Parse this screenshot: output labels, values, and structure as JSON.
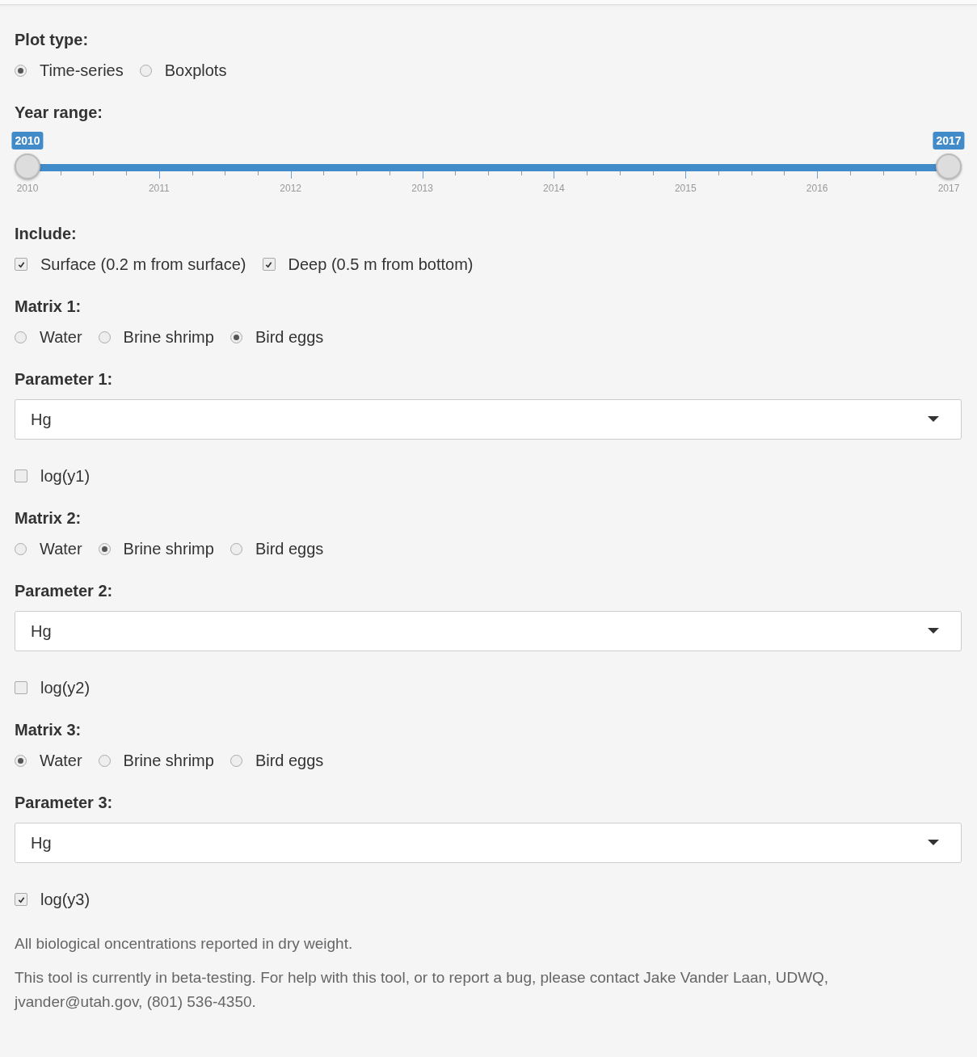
{
  "sections": [
    {
      "kind": "radio",
      "label": "Plot type:",
      "options": [
        {
          "label": "Time-series",
          "selected": true
        },
        {
          "label": "Boxplots",
          "selected": false
        }
      ]
    },
    {
      "kind": "slider",
      "label": "Year range:",
      "from": {
        "value": "2010",
        "level": 0
      },
      "to": {
        "value": "2017",
        "level": 1
      },
      "ticks": [
        "2010",
        "2011",
        "2012",
        "2013",
        "2014",
        "2015",
        "2016",
        "2017"
      ]
    },
    {
      "kind": "checks",
      "label": "Include:",
      "options": [
        {
          "label": "Surface (0.2 m from surface)",
          "checked": true
        },
        {
          "label": "Deep (0.5 m from bottom)",
          "checked": true
        }
      ]
    },
    {
      "kind": "radio",
      "label": "Matrix 1:",
      "options": [
        {
          "label": "Water",
          "selected": false
        },
        {
          "label": "Brine shrimp",
          "selected": false
        },
        {
          "label": "Bird eggs",
          "selected": true
        }
      ]
    },
    {
      "kind": "select",
      "label": "Parameter 1:",
      "value": "Hg"
    },
    {
      "kind": "checks",
      "options": [
        {
          "label": "log(y1)",
          "checked": false
        }
      ]
    },
    {
      "kind": "radio",
      "label": "Matrix 2:",
      "options": [
        {
          "label": "Water",
          "selected": false
        },
        {
          "label": "Brine shrimp",
          "selected": true
        },
        {
          "label": "Bird eggs",
          "selected": false
        }
      ]
    },
    {
      "kind": "select",
      "label": "Parameter 2:",
      "value": "Hg"
    },
    {
      "kind": "checks",
      "options": [
        {
          "label": "log(y2)",
          "checked": false
        }
      ]
    },
    {
      "kind": "radio",
      "label": "Matrix 3:",
      "options": [
        {
          "label": "Water",
          "selected": true
        },
        {
          "label": "Brine shrimp",
          "selected": false
        },
        {
          "label": "Bird eggs",
          "selected": false
        }
      ]
    },
    {
      "kind": "select",
      "label": "Parameter 3:",
      "value": "Hg"
    },
    {
      "kind": "checks",
      "options": [
        {
          "label": "log(y3)",
          "checked": true
        }
      ]
    },
    {
      "kind": "note",
      "text": "All biological oncentrations reported in dry weight."
    },
    {
      "kind": "note",
      "text": "This tool is currently in beta-testing. For help with this tool, or to report a bug, please contact Jake Vander Laan, UDWQ, jvander@utah.gov, (801) 536-4350."
    }
  ]
}
